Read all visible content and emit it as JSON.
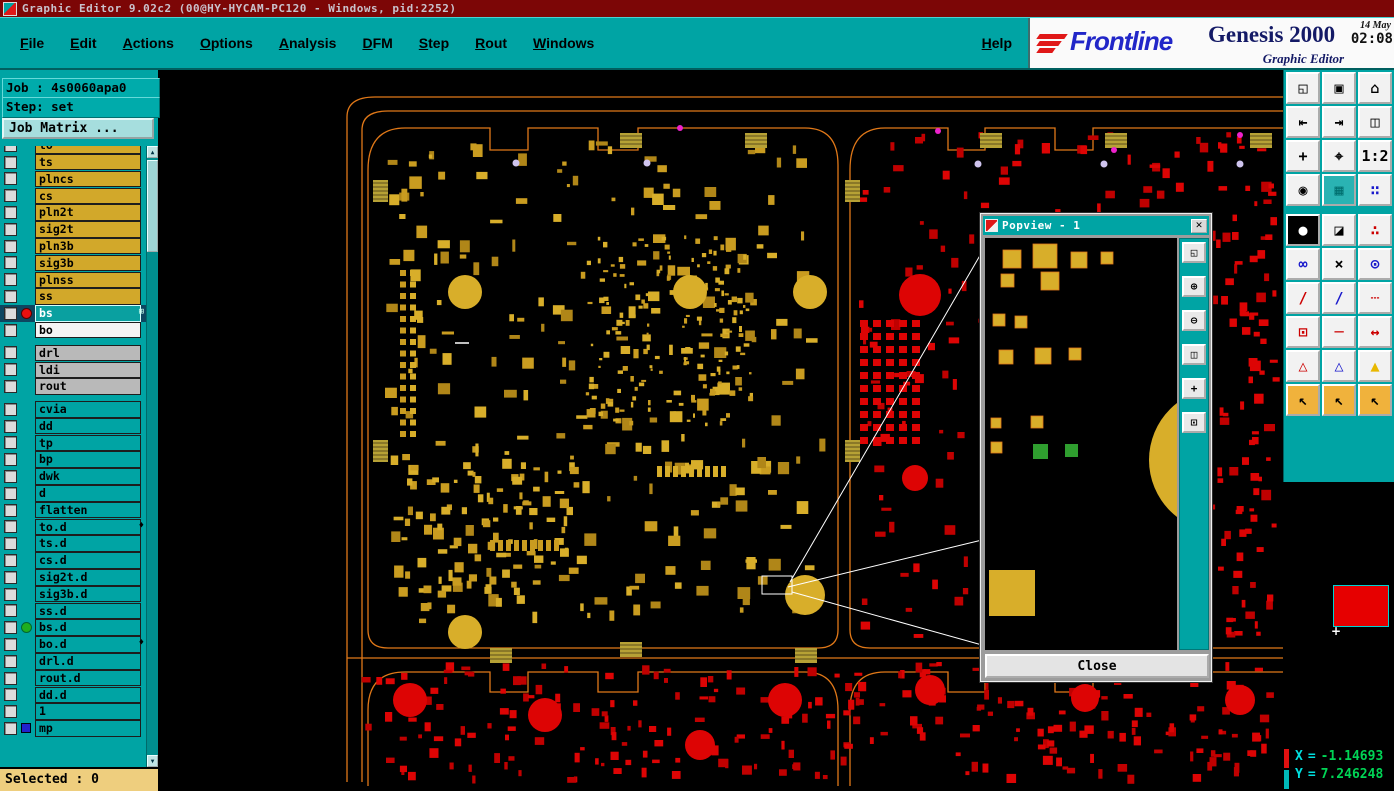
{
  "colors": {
    "teal": "#00a4a4",
    "title_bar_bg": "#7c0606",
    "board_outline": "#e07818",
    "pad_gold": "#c99c20",
    "pad_gold2": "#d8ae2a",
    "pad_gold3": "#b08618",
    "pad_red": "#dd0404",
    "pad_red2": "#c00000",
    "pad_khaki": "#b6a135",
    "magenta": "#ee22cc",
    "lavender": "#cfc4ee",
    "pad_green": "#2f9e2f",
    "white": "#ffffff"
  },
  "title_bar": {
    "title": "Graphic Editor 9.02c2 (00@HY-HYCAM-PC120 - Windows, pid:2252)"
  },
  "menu": {
    "items": [
      "File",
      "Edit",
      "Actions",
      "Options",
      "Analysis",
      "DFM",
      "Step",
      "Rout",
      "Windows"
    ],
    "help_label": "Help"
  },
  "brand": {
    "logo_text": "Frontline",
    "product": "Genesis 2000",
    "date": "14 May",
    "time": "02:08",
    "subtitle": "Graphic Editor"
  },
  "job_panel": {
    "job_label": "Job : 4s0060apa0",
    "step_label": "Step: set",
    "matrix_label": "Job Matrix ..."
  },
  "layers": [
    {
      "name": "to",
      "color": "gold"
    },
    {
      "name": "ts",
      "color": "gold"
    },
    {
      "name": "plncs",
      "color": "gold"
    },
    {
      "name": "cs",
      "color": "gold"
    },
    {
      "name": "pln2t",
      "color": "gold"
    },
    {
      "name": "sig2t",
      "color": "gold"
    },
    {
      "name": "pln3b",
      "color": "gold"
    },
    {
      "name": "sig3b",
      "color": "gold"
    },
    {
      "name": "plnss",
      "color": "gold"
    },
    {
      "name": "ss",
      "color": "gold"
    },
    {
      "name": "bs",
      "color": "sel",
      "dot": "red",
      "mark": "⊞"
    },
    {
      "name": "bo",
      "color": "white"
    },
    {
      "gap": true
    },
    {
      "name": "drl",
      "color": "gray"
    },
    {
      "name": "ldi",
      "color": "gray"
    },
    {
      "name": "rout",
      "color": "gray"
    },
    {
      "gap": true
    },
    {
      "name": "cvia",
      "color": "teal"
    },
    {
      "name": "dd",
      "color": "teal"
    },
    {
      "name": "tp",
      "color": "teal"
    },
    {
      "name": "bp",
      "color": "teal"
    },
    {
      "name": "dwk",
      "color": "teal"
    },
    {
      "name": "d",
      "color": "teal"
    },
    {
      "name": "flatten",
      "color": "teal"
    },
    {
      "name": "to.d",
      "color": "teal",
      "mark": "♦"
    },
    {
      "name": "ts.d",
      "color": "teal"
    },
    {
      "name": "cs.d",
      "color": "teal"
    },
    {
      "name": "sig2t.d",
      "color": "teal"
    },
    {
      "name": "sig3b.d",
      "color": "teal"
    },
    {
      "name": "ss.d",
      "color": "teal"
    },
    {
      "name": "bs.d",
      "color": "teal",
      "dot": "green"
    },
    {
      "name": "bo.d",
      "color": "teal",
      "mark": "♦"
    },
    {
      "name": "drl.d",
      "color": "teal"
    },
    {
      "name": "rout.d",
      "color": "teal"
    },
    {
      "name": "dd.d",
      "color": "teal"
    },
    {
      "name": "1",
      "color": "teal"
    },
    {
      "name": "mp",
      "color": "teal",
      "dot": "bluesq"
    }
  ],
  "selected_bar": "Selected : 0",
  "scrollbar": {
    "up": "▲",
    "down": "▼"
  },
  "toolbar": {
    "buttons": [
      {
        "n": "screen-copy-icon",
        "g": "◱"
      },
      {
        "n": "monitor-icon",
        "g": "▣"
      },
      {
        "n": "home-view-icon",
        "g": "⌂"
      },
      {
        "n": "view-prev-icon",
        "g": "⇤"
      },
      {
        "n": "view-next-icon",
        "g": "⇥"
      },
      {
        "n": "window-scale-icon",
        "g": "◫"
      },
      {
        "n": "pan-view-icon",
        "g": "+"
      },
      {
        "n": "center-target-icon",
        "g": "⌖"
      },
      {
        "n": "scale-1-2-icon",
        "g": "1:2"
      },
      {
        "n": "redraw-icon",
        "g": "◉"
      },
      {
        "n": "grid-toggle-icon",
        "g": "▦",
        "fg": "#006f6f",
        "bg": "#2ab3b3"
      },
      {
        "n": "snap-grid-icon",
        "g": "∷",
        "fg": "#1a1acc"
      },
      {
        "n": "origin-icon",
        "g": "●",
        "fg": "#ffffff",
        "bg": "#000000"
      },
      {
        "n": "shade-mode-icon",
        "g": "◪"
      },
      {
        "n": "select-points-icon",
        "g": "∴",
        "fg": "#cc0000"
      },
      {
        "n": "net-connect-icon",
        "g": "∞",
        "fg": "#1a1acc"
      },
      {
        "n": "clear-highlight-icon",
        "g": "×"
      },
      {
        "n": "highlight-net-icon",
        "g": "⊙",
        "fg": "#1a1acc"
      },
      {
        "n": "measure-red-icon",
        "g": "/",
        "fg": "#cc0000"
      },
      {
        "n": "measure-blue-icon",
        "g": "/",
        "fg": "#1a1acc"
      },
      {
        "n": "dash-line-icon",
        "g": "┄",
        "fg": "#cc0000"
      },
      {
        "n": "pad-origin-icon",
        "g": "⊡",
        "fg": "#cc0000"
      },
      {
        "n": "red-line-icon",
        "g": "─",
        "fg": "#cc0000"
      },
      {
        "n": "stretch-icon",
        "g": "↔",
        "fg": "#cc0000"
      },
      {
        "n": "drc-red-triangle-icon",
        "g": "△",
        "fg": "#cc0000"
      },
      {
        "n": "drc-blue-triangle-icon",
        "g": "△",
        "fg": "#1a1acc"
      },
      {
        "n": "drc-yellow-triangle-icon",
        "g": "▲",
        "fg": "#e8b800"
      },
      {
        "n": "cursor-select-icon",
        "g": "↖",
        "bg": "#f0b23c"
      },
      {
        "n": "cursor-add-icon",
        "g": "↖",
        "bg": "#f0b23c"
      },
      {
        "n": "cursor-menu-icon",
        "g": "↖",
        "bg": "#f0b23c"
      }
    ]
  },
  "popview": {
    "title": "Popview - 1",
    "close_icon": "✕",
    "close_label": "Close",
    "tools": [
      {
        "n": "popview-zoom-sel-icon",
        "g": "◱"
      },
      {
        "n": "popview-zoom-in-icon",
        "g": "⊕"
      },
      {
        "n": "popview-zoom-out-icon",
        "g": "⊖"
      },
      {
        "n": "popview-prev-view-icon",
        "g": "◫"
      },
      {
        "n": "popview-pan-icon",
        "g": "+"
      },
      {
        "n": "popview-fit-icon",
        "g": "⊡"
      }
    ]
  },
  "overview": {
    "cursor_glyph": "+"
  },
  "status": {
    "x_label": "X",
    "y_label": "Y",
    "eq": "=",
    "x_value": "-1.14693",
    "y_value": "7.246248"
  }
}
